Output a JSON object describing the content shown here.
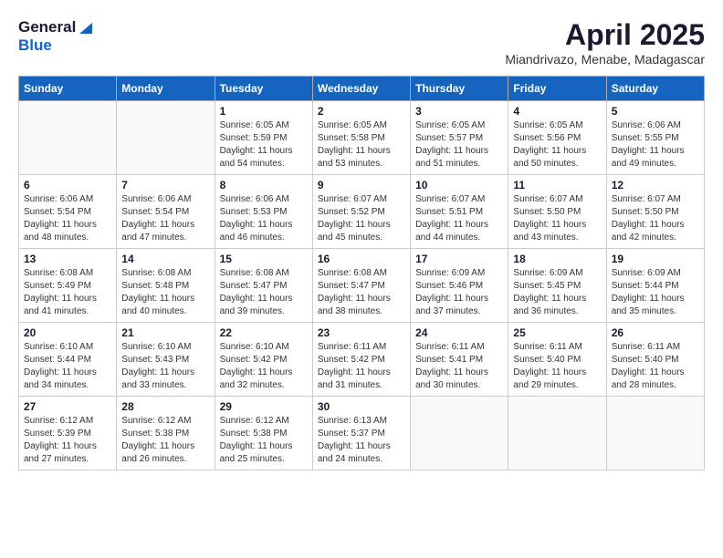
{
  "header": {
    "logo_general": "General",
    "logo_blue": "Blue",
    "month_year": "April 2025",
    "subtitle": "Miandrivazo, Menabe, Madagascar"
  },
  "calendar": {
    "days_of_week": [
      "Sunday",
      "Monday",
      "Tuesday",
      "Wednesday",
      "Thursday",
      "Friday",
      "Saturday"
    ],
    "weeks": [
      [
        {
          "day": "",
          "detail": ""
        },
        {
          "day": "",
          "detail": ""
        },
        {
          "day": "1",
          "detail": "Sunrise: 6:05 AM\nSunset: 5:59 PM\nDaylight: 11 hours and 54 minutes."
        },
        {
          "day": "2",
          "detail": "Sunrise: 6:05 AM\nSunset: 5:58 PM\nDaylight: 11 hours and 53 minutes."
        },
        {
          "day": "3",
          "detail": "Sunrise: 6:05 AM\nSunset: 5:57 PM\nDaylight: 11 hours and 51 minutes."
        },
        {
          "day": "4",
          "detail": "Sunrise: 6:05 AM\nSunset: 5:56 PM\nDaylight: 11 hours and 50 minutes."
        },
        {
          "day": "5",
          "detail": "Sunrise: 6:06 AM\nSunset: 5:55 PM\nDaylight: 11 hours and 49 minutes."
        }
      ],
      [
        {
          "day": "6",
          "detail": "Sunrise: 6:06 AM\nSunset: 5:54 PM\nDaylight: 11 hours and 48 minutes."
        },
        {
          "day": "7",
          "detail": "Sunrise: 6:06 AM\nSunset: 5:54 PM\nDaylight: 11 hours and 47 minutes."
        },
        {
          "day": "8",
          "detail": "Sunrise: 6:06 AM\nSunset: 5:53 PM\nDaylight: 11 hours and 46 minutes."
        },
        {
          "day": "9",
          "detail": "Sunrise: 6:07 AM\nSunset: 5:52 PM\nDaylight: 11 hours and 45 minutes."
        },
        {
          "day": "10",
          "detail": "Sunrise: 6:07 AM\nSunset: 5:51 PM\nDaylight: 11 hours and 44 minutes."
        },
        {
          "day": "11",
          "detail": "Sunrise: 6:07 AM\nSunset: 5:50 PM\nDaylight: 11 hours and 43 minutes."
        },
        {
          "day": "12",
          "detail": "Sunrise: 6:07 AM\nSunset: 5:50 PM\nDaylight: 11 hours and 42 minutes."
        }
      ],
      [
        {
          "day": "13",
          "detail": "Sunrise: 6:08 AM\nSunset: 5:49 PM\nDaylight: 11 hours and 41 minutes."
        },
        {
          "day": "14",
          "detail": "Sunrise: 6:08 AM\nSunset: 5:48 PM\nDaylight: 11 hours and 40 minutes."
        },
        {
          "day": "15",
          "detail": "Sunrise: 6:08 AM\nSunset: 5:47 PM\nDaylight: 11 hours and 39 minutes."
        },
        {
          "day": "16",
          "detail": "Sunrise: 6:08 AM\nSunset: 5:47 PM\nDaylight: 11 hours and 38 minutes."
        },
        {
          "day": "17",
          "detail": "Sunrise: 6:09 AM\nSunset: 5:46 PM\nDaylight: 11 hours and 37 minutes."
        },
        {
          "day": "18",
          "detail": "Sunrise: 6:09 AM\nSunset: 5:45 PM\nDaylight: 11 hours and 36 minutes."
        },
        {
          "day": "19",
          "detail": "Sunrise: 6:09 AM\nSunset: 5:44 PM\nDaylight: 11 hours and 35 minutes."
        }
      ],
      [
        {
          "day": "20",
          "detail": "Sunrise: 6:10 AM\nSunset: 5:44 PM\nDaylight: 11 hours and 34 minutes."
        },
        {
          "day": "21",
          "detail": "Sunrise: 6:10 AM\nSunset: 5:43 PM\nDaylight: 11 hours and 33 minutes."
        },
        {
          "day": "22",
          "detail": "Sunrise: 6:10 AM\nSunset: 5:42 PM\nDaylight: 11 hours and 32 minutes."
        },
        {
          "day": "23",
          "detail": "Sunrise: 6:11 AM\nSunset: 5:42 PM\nDaylight: 11 hours and 31 minutes."
        },
        {
          "day": "24",
          "detail": "Sunrise: 6:11 AM\nSunset: 5:41 PM\nDaylight: 11 hours and 30 minutes."
        },
        {
          "day": "25",
          "detail": "Sunrise: 6:11 AM\nSunset: 5:40 PM\nDaylight: 11 hours and 29 minutes."
        },
        {
          "day": "26",
          "detail": "Sunrise: 6:11 AM\nSunset: 5:40 PM\nDaylight: 11 hours and 28 minutes."
        }
      ],
      [
        {
          "day": "27",
          "detail": "Sunrise: 6:12 AM\nSunset: 5:39 PM\nDaylight: 11 hours and 27 minutes."
        },
        {
          "day": "28",
          "detail": "Sunrise: 6:12 AM\nSunset: 5:38 PM\nDaylight: 11 hours and 26 minutes."
        },
        {
          "day": "29",
          "detail": "Sunrise: 6:12 AM\nSunset: 5:38 PM\nDaylight: 11 hours and 25 minutes."
        },
        {
          "day": "30",
          "detail": "Sunrise: 6:13 AM\nSunset: 5:37 PM\nDaylight: 11 hours and 24 minutes."
        },
        {
          "day": "",
          "detail": ""
        },
        {
          "day": "",
          "detail": ""
        },
        {
          "day": "",
          "detail": ""
        }
      ]
    ]
  }
}
